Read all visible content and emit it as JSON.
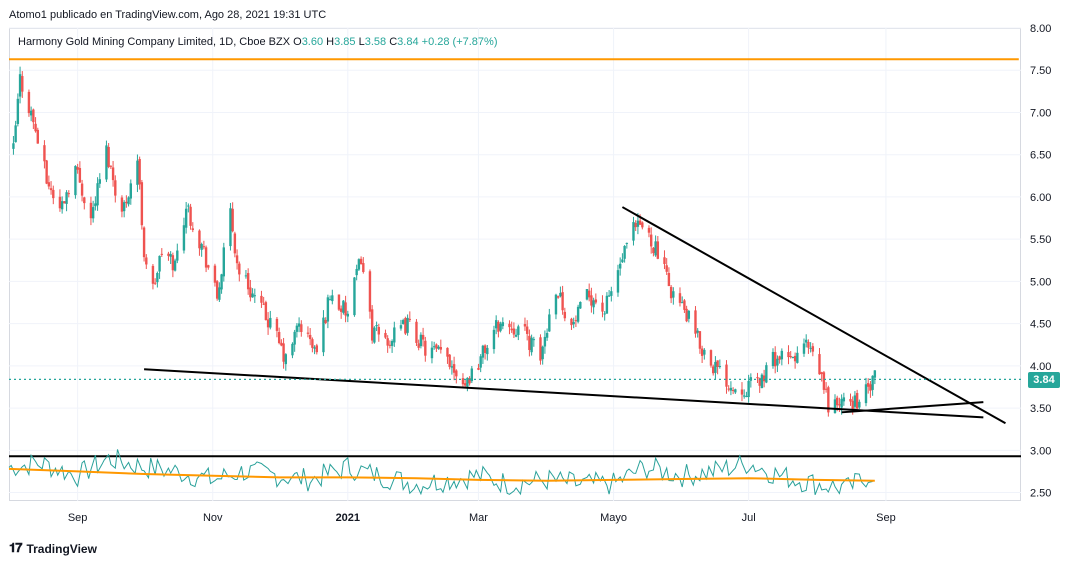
{
  "header": {
    "credit": "Atomo1 publicado en TradingView.com, Ago 28, 2021 19:31 UTC"
  },
  "legend": {
    "symbol": "Harmony Gold Mining Company Limited, 1D, Cboe BZX",
    "o_label": "O",
    "o": "3.60",
    "h_label": "H",
    "h": "3.85",
    "l_label": "L",
    "l": "3.58",
    "c_label": "C",
    "c": "3.84",
    "change": "+0.28 (+7.87%)"
  },
  "price_tag": "3.84",
  "footer": {
    "brand": "TradingView"
  },
  "colors": {
    "up": "#26a69a",
    "down": "#ef5350",
    "resistance": "#ff9800",
    "trendline": "#000000",
    "indicator": "#2aa19a",
    "indicator_ma": "#ff9800",
    "last_price": "#26a69a",
    "grid": "#f0f3fa"
  },
  "chart_data": {
    "type": "candlestick",
    "ylim": [
      2.4,
      8.0
    ],
    "y_ticks": [
      "8.00",
      "7.50",
      "7.00",
      "6.50",
      "6.00",
      "5.50",
      "5.00",
      "4.50",
      "4.00",
      "3.50",
      "3.00",
      "2.50"
    ],
    "y_tick_values": [
      8.0,
      7.5,
      7.0,
      6.5,
      6.0,
      5.5,
      5.0,
      4.5,
      4.0,
      3.5,
      3.0,
      2.5
    ],
    "x_ticks": [
      "Sep",
      "Nov",
      "2021",
      "Mar",
      "Mayo",
      "Jul",
      "Sep"
    ],
    "x_tick_dates": [
      "2020-09-01",
      "2020-11-01",
      "2021-01-01",
      "2021-03-01",
      "2021-05-01",
      "2021-07-01",
      "2021-09-01"
    ],
    "x_range": [
      "2020-08-01",
      "2021-11-01"
    ],
    "last_price": 3.84,
    "resistance_level": 7.63,
    "resistance_range": [
      "2020-08-01",
      "2021-10-31"
    ],
    "indicator_level": 2.93,
    "price_path": [
      [
        "2020-08-03",
        6.55
      ],
      [
        "2020-08-06",
        7.4
      ],
      [
        "2020-08-12",
        6.9
      ],
      [
        "2020-08-18",
        6.2
      ],
      [
        "2020-08-24",
        5.85
      ],
      [
        "2020-08-31",
        6.35
      ],
      [
        "2020-09-07",
        5.75
      ],
      [
        "2020-09-14",
        6.55
      ],
      [
        "2020-09-21",
        5.8
      ],
      [
        "2020-09-28",
        6.45
      ],
      [
        "2020-10-01",
        5.35
      ],
      [
        "2020-10-05",
        4.9
      ],
      [
        "2020-10-09",
        5.35
      ],
      [
        "2020-10-15",
        5.2
      ],
      [
        "2020-10-20",
        5.9
      ],
      [
        "2020-10-28",
        5.35
      ],
      [
        "2020-11-03",
        4.8
      ],
      [
        "2020-11-06",
        5.3
      ],
      [
        "2020-11-09",
        5.8
      ],
      [
        "2020-11-12",
        5.2
      ],
      [
        "2020-11-20",
        4.8
      ],
      [
        "2020-11-28",
        4.45
      ],
      [
        "2020-12-04",
        4.05
      ],
      [
        "2020-12-10",
        4.5
      ],
      [
        "2020-12-18",
        4.15
      ],
      [
        "2020-12-24",
        4.85
      ],
      [
        "2021-01-01",
        4.6
      ],
      [
        "2021-01-07",
        5.3
      ],
      [
        "2021-01-12",
        4.4
      ],
      [
        "2021-01-20",
        4.3
      ],
      [
        "2021-01-28",
        4.5
      ],
      [
        "2021-02-05",
        4.2
      ],
      [
        "2021-02-15",
        4.1
      ],
      [
        "2021-02-23",
        3.8
      ],
      [
        "2021-03-01",
        4.05
      ],
      [
        "2021-03-10",
        4.5
      ],
      [
        "2021-03-20",
        4.45
      ],
      [
        "2021-03-29",
        4.1
      ],
      [
        "2021-04-05",
        4.95
      ],
      [
        "2021-04-12",
        4.45
      ],
      [
        "2021-04-20",
        4.85
      ],
      [
        "2021-04-27",
        4.65
      ],
      [
        "2021-05-04",
        5.2
      ],
      [
        "2021-05-10",
        5.6
      ],
      [
        "2021-05-14",
        5.65
      ],
      [
        "2021-05-20",
        5.4
      ],
      [
        "2021-05-26",
        4.95
      ],
      [
        "2021-06-03",
        4.6
      ],
      [
        "2021-06-10",
        4.2
      ],
      [
        "2021-06-17",
        3.95
      ],
      [
        "2021-06-24",
        3.75
      ],
      [
        "2021-07-01",
        3.75
      ],
      [
        "2021-07-07",
        3.85
      ],
      [
        "2021-07-13",
        4.1
      ],
      [
        "2021-07-20",
        4.05
      ],
      [
        "2021-07-27",
        4.25
      ],
      [
        "2021-08-03",
        3.85
      ],
      [
        "2021-08-06",
        3.55
      ],
      [
        "2021-08-13",
        3.55
      ],
      [
        "2021-08-20",
        3.6
      ],
      [
        "2021-08-25",
        3.75
      ],
      [
        "2021-08-27",
        3.84
      ]
    ],
    "trendlines": [
      {
        "from": [
          "2020-10-01",
          3.96
        ],
        "to": [
          "2021-10-15",
          3.39
        ]
      },
      {
        "from": [
          "2021-05-05",
          5.88
        ],
        "to": [
          "2021-10-25",
          3.32
        ]
      },
      {
        "from": [
          "2021-08-12",
          3.45
        ],
        "to": [
          "2021-10-15",
          3.57
        ]
      }
    ],
    "indicator_path": [
      [
        "2020-08-01",
        2.8
      ],
      [
        "2020-08-15",
        2.85
      ],
      [
        "2020-09-01",
        2.7
      ],
      [
        "2020-09-15",
        2.9
      ],
      [
        "2020-10-01",
        2.8
      ],
      [
        "2020-10-15",
        2.75
      ],
      [
        "2020-11-01",
        2.65
      ],
      [
        "2020-11-15",
        2.75
      ],
      [
        "2020-12-01",
        2.7
      ],
      [
        "2020-12-15",
        2.65
      ],
      [
        "2021-01-01",
        2.8
      ],
      [
        "2021-01-15",
        2.7
      ],
      [
        "2021-02-01",
        2.6
      ],
      [
        "2021-02-15",
        2.65
      ],
      [
        "2021-03-01",
        2.7
      ],
      [
        "2021-03-15",
        2.6
      ],
      [
        "2021-04-01",
        2.65
      ],
      [
        "2021-04-15",
        2.6
      ],
      [
        "2021-05-01",
        2.6
      ],
      [
        "2021-05-15",
        2.8
      ],
      [
        "2021-06-01",
        2.7
      ],
      [
        "2021-06-15",
        2.75
      ],
      [
        "2021-07-01",
        2.85
      ],
      [
        "2021-07-15",
        2.7
      ],
      [
        "2021-08-01",
        2.6
      ],
      [
        "2021-08-15",
        2.55
      ],
      [
        "2021-08-27",
        2.75
      ]
    ],
    "indicator_ma_path": [
      [
        "2020-08-01",
        2.78
      ],
      [
        "2020-09-01",
        2.75
      ],
      [
        "2020-10-01",
        2.72
      ],
      [
        "2020-11-01",
        2.7
      ],
      [
        "2020-12-01",
        2.68
      ],
      [
        "2021-01-01",
        2.68
      ],
      [
        "2021-02-01",
        2.67
      ],
      [
        "2021-03-01",
        2.65
      ],
      [
        "2021-04-01",
        2.64
      ],
      [
        "2021-05-01",
        2.65
      ],
      [
        "2021-06-01",
        2.66
      ],
      [
        "2021-07-01",
        2.67
      ],
      [
        "2021-08-01",
        2.65
      ],
      [
        "2021-08-27",
        2.64
      ]
    ]
  }
}
